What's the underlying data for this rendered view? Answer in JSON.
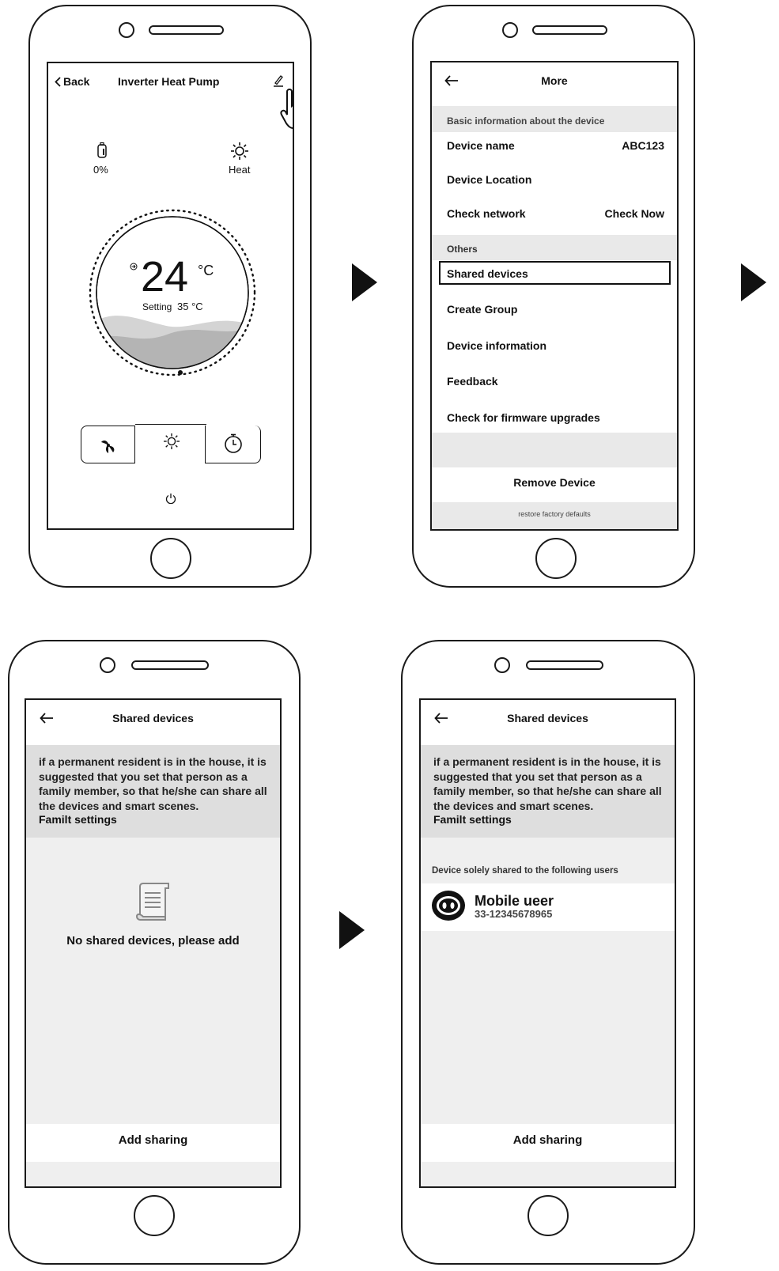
{
  "screen1": {
    "back_label": "Back",
    "title": "Inverter Heat Pump",
    "humidity_value": "0%",
    "mode_label": "Heat",
    "temperature": "24",
    "temperature_unit": "°C",
    "setting_label": "Setting",
    "setting_value": "35 °C",
    "icons": [
      "back-chevron-icon",
      "edit-pencil-icon",
      "tap-hand-icon",
      "water-tank-icon",
      "sun-icon",
      "fan-icon",
      "sun-icon",
      "timer-icon",
      "power-icon"
    ]
  },
  "screen2": {
    "title": "More",
    "section_basic": "Basic information about the device",
    "device_name_label": "Device name",
    "device_name_value": "ABC123",
    "device_location_label": "Device Location",
    "check_network_label": "Check network",
    "check_network_action": "Check Now",
    "section_others": "Others",
    "items": [
      "Shared devices",
      "Create Group",
      "Device information",
      "Feedback",
      "Check for firmware upgrades"
    ],
    "remove_device": "Remove Device",
    "restore_label": "restore factory defaults"
  },
  "screen3": {
    "title": "Shared devices",
    "info_text": "if a permanent resident is in the house, it is suggested that you set that person as a family member, so that he/she can share all the devices and smart scenes.",
    "info_link": "Familt settings",
    "empty_text": "No shared devices, please add",
    "add_sharing": "Add sharing"
  },
  "screen4": {
    "title": "Shared devices",
    "info_text": "if a permanent resident is in the house, it is suggested that you set that person as a family member, so that he/she can share all the devices and smart scenes.",
    "info_link": "Familt settings",
    "section_label": "Device solely shared to the following users",
    "user_name": "Mobile ueer",
    "user_phone": "33-12345678965",
    "add_sharing": "Add sharing"
  }
}
